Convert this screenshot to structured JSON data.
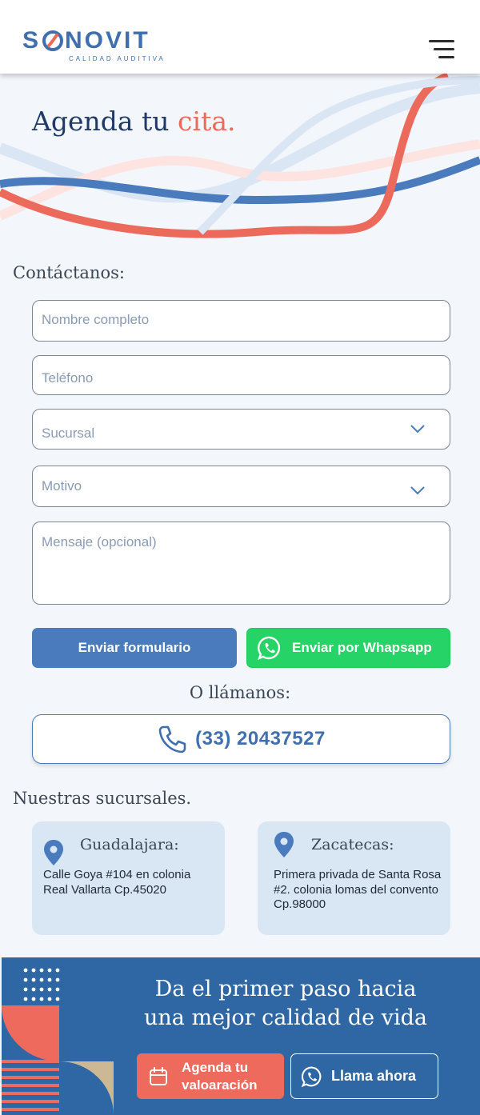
{
  "brand": {
    "name_part1": "S",
    "name_part2": "NOVIT",
    "tagline": "CALIDAD AUDITIVA"
  },
  "icons": {
    "menu": "hamburger-menu-icon",
    "chevron": "chevron-down-icon",
    "whatsapp": "whatsapp-icon",
    "phone": "phone-icon",
    "pin": "map-pin-icon",
    "calendar": "calendar-icon"
  },
  "colors": {
    "primary": "#4a7bbc",
    "accent": "#ec6a5c",
    "whatsapp": "#25d366",
    "dark_blue": "#2f67a4"
  },
  "hero": {
    "title_main": "Agenda tu ",
    "title_accent": "cita."
  },
  "contact": {
    "heading": "Contáctanos:",
    "fields": {
      "name_placeholder": "Nombre completo",
      "phone_placeholder": "Teléfono",
      "branch_placeholder": "Sucursal",
      "reason_placeholder": "Motivo",
      "message_placeholder": "Mensaje (opcional)"
    },
    "submit_label": "Enviar formulario",
    "whatsapp_label": "Enviar por Whapsapp"
  },
  "call": {
    "heading": "O llámanos:",
    "phone_number": "(33) 20437527"
  },
  "branches": {
    "heading": "Nuestras sucursales.",
    "items": [
      {
        "name": "Guadalajara:",
        "address": "Calle Goya #104 en colonia Real Vallarta Cp.45020"
      },
      {
        "name": "Zacatecas:",
        "address": "Primera privada de Santa Rosa #2. colonia lomas del convento Cp.98000"
      }
    ]
  },
  "cta": {
    "title_line1": "Da el primer paso hacia",
    "title_line2": "una mejor calidad de vida",
    "schedule_line1": "Agenda tu",
    "schedule_line2": "valoaración",
    "call_label": "Llama ahora"
  }
}
